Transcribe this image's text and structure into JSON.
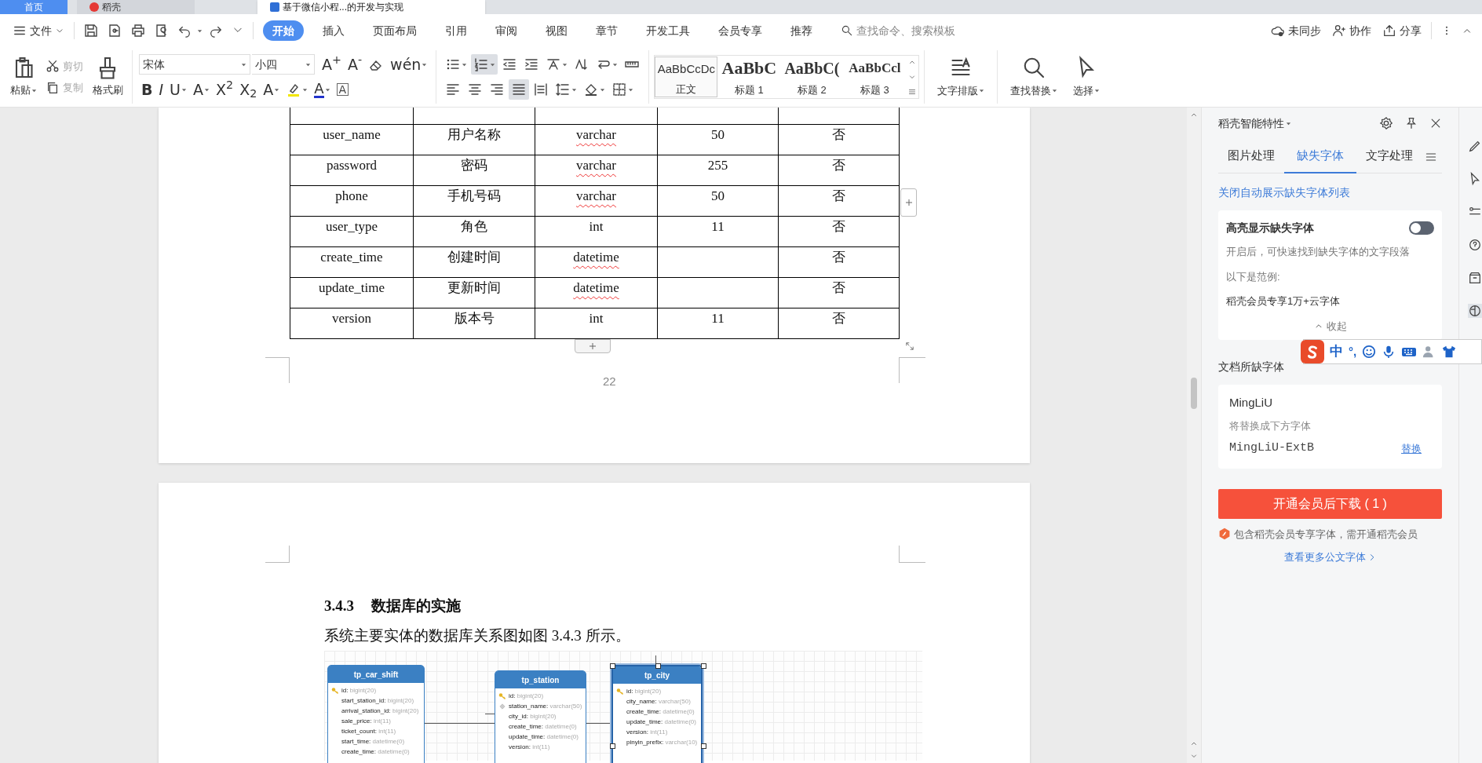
{
  "app_tabs": [
    {
      "label": "首页",
      "kind": "home",
      "selected": false
    },
    {
      "label": "稻壳",
      "kind": "docer",
      "selected": false
    },
    {
      "label": "基于微信小程...的开发与实现",
      "kind": "doc",
      "selected": true
    }
  ],
  "menu": {
    "file": "文件",
    "tabs": [
      {
        "label": "开始",
        "selected": true
      },
      {
        "label": "插入",
        "selected": false
      },
      {
        "label": "页面布局",
        "selected": false
      },
      {
        "label": "引用",
        "selected": false
      },
      {
        "label": "审阅",
        "selected": false
      },
      {
        "label": "视图",
        "selected": false
      },
      {
        "label": "章节",
        "selected": false
      },
      {
        "label": "开发工具",
        "selected": false
      },
      {
        "label": "会员专享",
        "selected": false
      },
      {
        "label": "推荐",
        "selected": false
      }
    ],
    "search": {
      "placeholder": "查找命令、搜索模板"
    },
    "actions": [
      {
        "label": "未同步",
        "kind": "cloud"
      },
      {
        "label": "协作",
        "kind": "person"
      },
      {
        "label": "分享",
        "kind": "share"
      }
    ]
  },
  "ribbon": {
    "paste": "粘贴",
    "clipboard_small": [
      {
        "label": "剪切",
        "kind": "cut",
        "disabled": true
      },
      {
        "label": "复制",
        "kind": "copy",
        "disabled": true
      }
    ],
    "format_painter": "格式刷",
    "font": "宋体",
    "size": "小四",
    "font_tools_top": [
      {
        "kind": "glyph",
        "text": "A$^{+}$",
        "dropdown": false
      },
      {
        "kind": "glyph",
        "text": "A$^{-}$",
        "dropdown": false
      },
      {
        "kind": "eraser",
        "dropdown": false
      },
      {
        "kind": "glyph",
        "text": "wén",
        "dropdown": true
      }
    ],
    "font_tools_bottom": [
      {
        "kind": "glyph",
        "text": "**B**",
        "dropdown": false
      },
      {
        "kind": "glyph",
        "text": "*I*",
        "dropdown": false
      },
      {
        "kind": "glyph",
        "text": "U",
        "dropdown": true
      },
      {
        "kind": "glyph",
        "text": "A",
        "dropdown": true
      },
      {
        "kind": "glyph",
        "text": "X$^{2}$",
        "dropdown": false
      },
      {
        "kind": "glyph",
        "text": "X$_{2}$",
        "dropdown": false
      },
      {
        "kind": "glyph",
        "text": "A",
        "dropdown": true
      },
      {
        "kind": "highlight",
        "dropdown": true
      },
      {
        "kind": "color",
        "text": "A",
        "dropdown": true
      },
      {
        "kind": "boxed",
        "text": "A",
        "dropdown": false
      }
    ],
    "para_top": [
      {
        "kind": "bullets",
        "selected": false
      },
      {
        "kind": "numbering",
        "selected": true
      },
      {
        "kind": "outdent",
        "selected": false
      },
      {
        "kind": "indent",
        "selected": false
      },
      {
        "kind": "asian",
        "selected": false
      },
      {
        "kind": "sort",
        "selected": false
      },
      {
        "kind": "linebreak",
        "selected": false
      },
      {
        "kind": "ruler",
        "selected": false
      }
    ],
    "para_bottom": [
      {
        "kind": "left",
        "selected": false
      },
      {
        "kind": "center",
        "selected": false
      },
      {
        "kind": "right",
        "selected": false
      },
      {
        "kind": "justify",
        "selected": true
      },
      {
        "kind": "distribute",
        "selected": false
      },
      {
        "kind": "spacing",
        "selected": false
      },
      {
        "kind": "shading",
        "selected": false
      },
      {
        "kind": "borders",
        "selected": false
      }
    ],
    "styles": [
      {
        "sample": "AaBbCcDc",
        "label": "正文",
        "kind": "body",
        "selected": true
      },
      {
        "sample": "AaBbC",
        "label": "标题 1",
        "kind": "h1",
        "selected": false
      },
      {
        "sample": "AaBbC(",
        "label": "标题 2",
        "kind": "h2",
        "selected": false
      },
      {
        "sample": "AaBbCcl",
        "label": "标题 3",
        "kind": "h3",
        "selected": false
      }
    ],
    "big_tools": [
      {
        "label": "文字排版",
        "kind": "layout"
      },
      {
        "label": "查找替换",
        "kind": "find"
      },
      {
        "label": "选择",
        "kind": "select"
      }
    ]
  },
  "document": {
    "table_rows": [
      {
        "cells": [
          "user_name",
          "用户名称",
          "varchar",
          "50",
          "否"
        ],
        "squiggle": true
      },
      {
        "cells": [
          "password",
          "密码",
          "varchar",
          "255",
          "否"
        ],
        "squiggle": true
      },
      {
        "cells": [
          "phone",
          "手机号码",
          "varchar",
          "50",
          "否"
        ],
        "squiggle": true
      },
      {
        "cells": [
          "user_type",
          "角色",
          "int",
          "11",
          "否"
        ],
        "squiggle": false
      },
      {
        "cells": [
          "create_time",
          "创建时间",
          "datetime",
          "",
          "否"
        ],
        "squiggle": true
      },
      {
        "cells": [
          "update_time",
          "更新时间",
          "datetime",
          "",
          "否"
        ],
        "squiggle": true
      },
      {
        "cells": [
          "version",
          "版本号",
          "int",
          "11",
          "否"
        ],
        "squiggle": false
      }
    ],
    "page_number": "22",
    "heading": {
      "number": "3.4.3",
      "title": "数据库的实施"
    },
    "paragraph": "系统主要实体的数据库关系图如图 3.4.3 所示。",
    "er_entities": [
      {
        "name": "tp_car_shift",
        "selected": false,
        "fields": [
          {
            "text": "id:",
            "type": "bigint(20)",
            "kind": "key"
          },
          {
            "text": "start_station_id:",
            "type": "bigint(20)",
            "kind": "plain"
          },
          {
            "text": "arrival_station_id:",
            "type": "bigint(20)",
            "kind": "plain"
          },
          {
            "text": "sale_price:",
            "type": "int(11)",
            "kind": "plain"
          },
          {
            "text": "ticket_count:",
            "type": "int(11)",
            "kind": "plain"
          },
          {
            "text": "start_time:",
            "type": "datetime(0)",
            "kind": "plain"
          },
          {
            "text": "create_time:",
            "type": "datetime(0)",
            "kind": "plain"
          }
        ]
      },
      {
        "name": "tp_station",
        "selected": false,
        "fields": [
          {
            "text": "id:",
            "type": "bigint(20)",
            "kind": "key"
          },
          {
            "text": "station_name:",
            "type": "varchar(50)",
            "kind": "index"
          },
          {
            "text": "city_id:",
            "type": "bigint(20)",
            "kind": "plain"
          },
          {
            "text": "create_time:",
            "type": "datetime(0)",
            "kind": "plain"
          },
          {
            "text": "update_time:",
            "type": "datetime(0)",
            "kind": "plain"
          },
          {
            "text": "version:",
            "type": "int(11)",
            "kind": "plain"
          }
        ]
      },
      {
        "name": "tp_city",
        "selected": true,
        "fields": [
          {
            "text": "id:",
            "type": "bigint(20)",
            "kind": "key"
          },
          {
            "text": "city_name:",
            "type": "varchar(50)",
            "kind": "plain"
          },
          {
            "text": "create_time:",
            "type": "datetime(0)",
            "kind": "plain"
          },
          {
            "text": "update_time:",
            "type": "datetime(0)",
            "kind": "plain"
          },
          {
            "text": "version:",
            "type": "int(11)",
            "kind": "plain"
          },
          {
            "text": "pinyin_prefix:",
            "type": "varchar(10)",
            "kind": "plain"
          }
        ]
      }
    ]
  },
  "panel": {
    "title": "稻壳智能特性",
    "tabs": [
      {
        "label": "图片处理",
        "selected": false
      },
      {
        "label": "缺失字体",
        "selected": true
      },
      {
        "label": "文字处理",
        "selected": false
      }
    ],
    "auto_link": "关闭自动展示缺失字体列表",
    "highlight": {
      "title": "高亮显示缺失字体",
      "on": false,
      "description": "开启后，可快速找到缺失字体的文字段落",
      "example_label": "以下是范例:",
      "example": "稻壳会员专享1万+云字体",
      "collapse": "收起"
    },
    "missing_title": "文档所缺字体",
    "missing_font": {
      "name": "MingLiU",
      "hint": "将替换成下方字体",
      "replacement": "MingLiU-ExtB",
      "action": "替换"
    },
    "download_button": "开通会员后下载 ( 1 )",
    "note": "包含稻壳会员专享字体，需开通稻壳会员",
    "more_link": "查看更多公文字体"
  },
  "ime": {
    "mode": "中",
    "punct": "°,"
  }
}
